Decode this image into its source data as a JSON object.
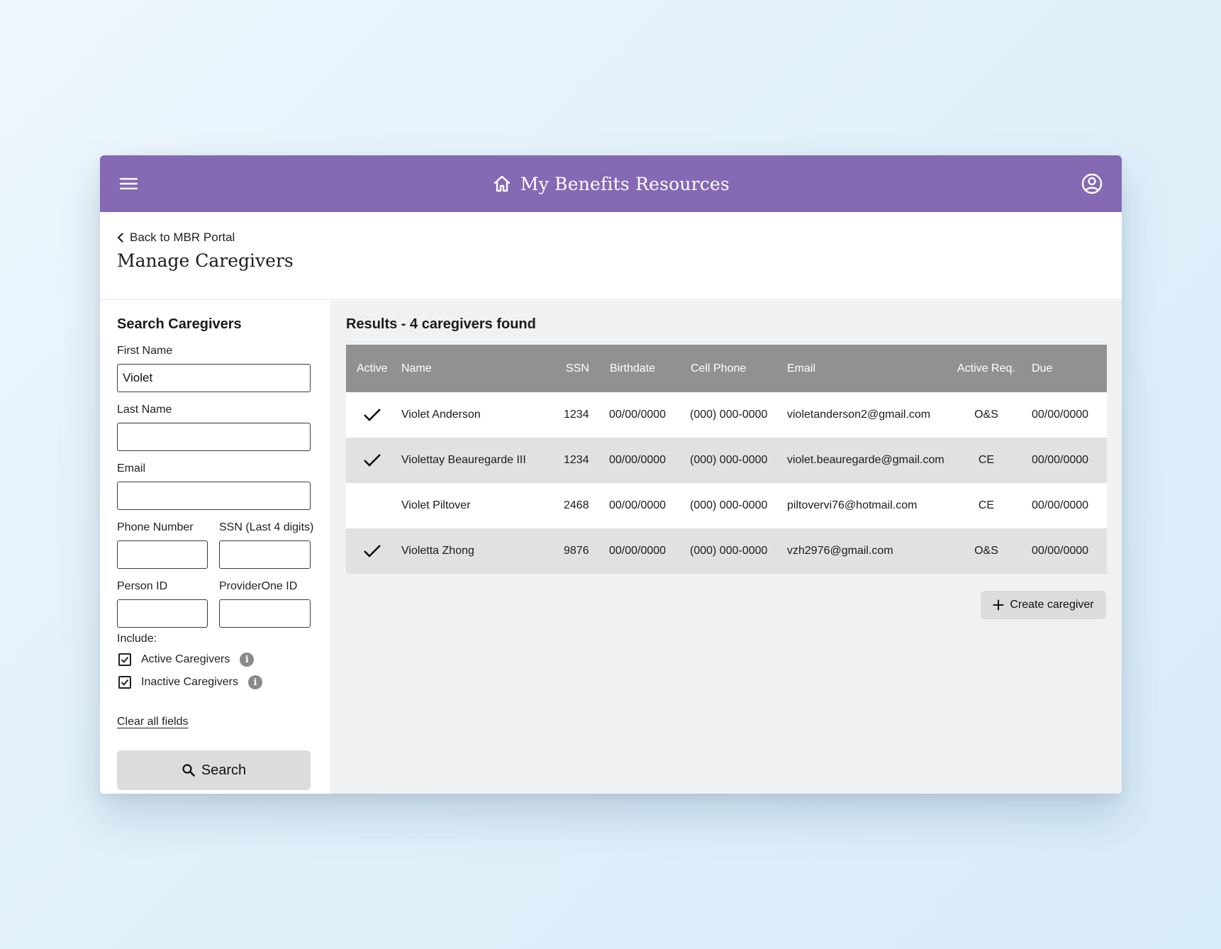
{
  "header": {
    "title": "My Benefits Resources",
    "icons": {
      "menu": "hamburger-menu-icon",
      "home": "home-icon",
      "account": "user-account-icon"
    },
    "color": "#8669b4"
  },
  "page": {
    "back_link": "Back to MBR Portal",
    "title": "Manage Caregivers"
  },
  "search": {
    "title": "Search Caregivers",
    "first_name": {
      "label": "First Name",
      "value": "Violet"
    },
    "last_name": {
      "label": "Last Name",
      "value": ""
    },
    "email": {
      "label": "Email",
      "value": ""
    },
    "phone": {
      "label": "Phone Number",
      "value": ""
    },
    "ssn": {
      "label": "SSN (Last 4 digits)",
      "value": ""
    },
    "person_id": {
      "label": "Person ID",
      "value": ""
    },
    "providerone_id": {
      "label": "ProviderOne ID",
      "value": ""
    },
    "include_label": "Include:",
    "include_options": [
      {
        "label": "Active Caregivers",
        "checked": true
      },
      {
        "label": "Inactive Caregivers",
        "checked": true
      }
    ],
    "clear_label": "Clear all fields",
    "search_button": "Search"
  },
  "results": {
    "title": "Results - 4 caregivers found",
    "columns": [
      "Active",
      "Name",
      "SSN",
      "Birthdate",
      "Cell Phone",
      "Email",
      "Active Req.",
      "Due"
    ],
    "rows": [
      {
        "active": true,
        "name": "Violet Anderson",
        "ssn": "1234",
        "birthdate": "00/00/0000",
        "phone": "(000) 000-0000",
        "email": "violetanderson2@gmail.com",
        "req": "O&S",
        "due": "00/00/0000"
      },
      {
        "active": true,
        "name": "Violettay Beauregarde III",
        "ssn": "1234",
        "birthdate": "00/00/0000",
        "phone": "(000) 000-0000",
        "email": "violet.beauregarde@gmail.com",
        "req": "CE",
        "due": "00/00/0000"
      },
      {
        "active": false,
        "name": "Violet Piltover",
        "ssn": "2468",
        "birthdate": "00/00/0000",
        "phone": "(000) 000-0000",
        "email": "piltovervi76@hotmail.com",
        "req": "CE",
        "due": "00/00/0000"
      },
      {
        "active": true,
        "name": "Violetta Zhong",
        "ssn": "9876",
        "birthdate": "00/00/0000",
        "phone": "(000) 000-0000",
        "email": "vzh2976@gmail.com",
        "req": "O&S",
        "due": "00/00/0000"
      }
    ],
    "create_button": "Create caregiver"
  }
}
